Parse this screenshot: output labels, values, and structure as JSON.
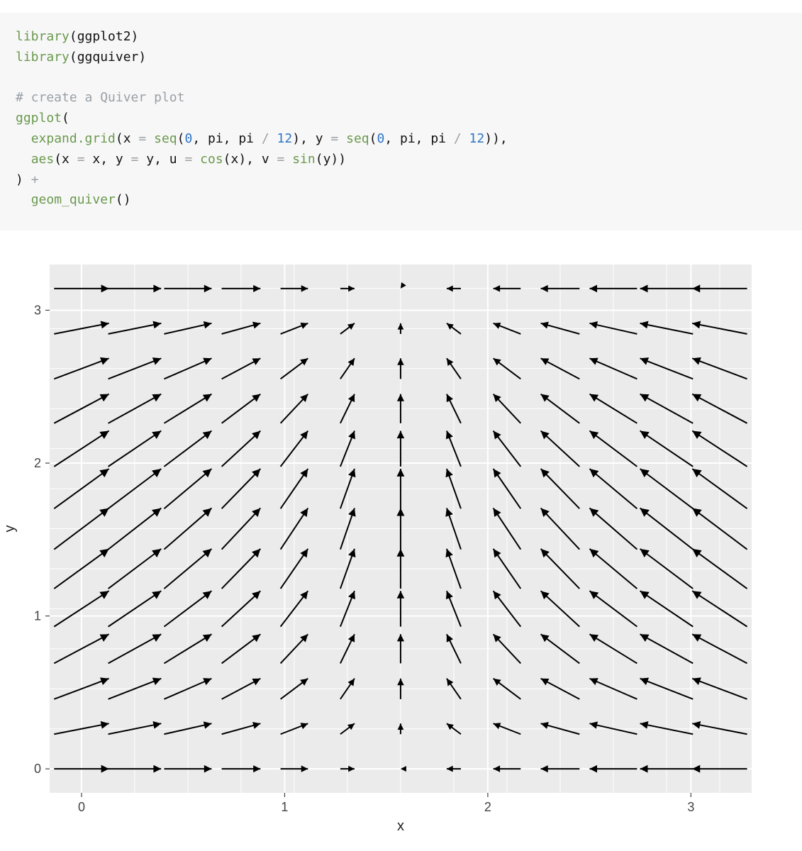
{
  "code": {
    "lines": [
      {
        "t": "mixed",
        "parts": [
          {
            "c": "fn",
            "s": "library"
          },
          {
            "c": "paren",
            "s": "(ggplot2)"
          }
        ]
      },
      {
        "t": "mixed",
        "parts": [
          {
            "c": "fn",
            "s": "library"
          },
          {
            "c": "paren",
            "s": "(ggquiver)"
          }
        ]
      },
      {
        "t": "blank"
      },
      {
        "t": "comment",
        "s": "# create a Quiver plot"
      },
      {
        "t": "mixed",
        "parts": [
          {
            "c": "fn",
            "s": "ggplot"
          },
          {
            "c": "paren",
            "s": "("
          }
        ]
      },
      {
        "t": "mixed",
        "parts": [
          {
            "c": "plain",
            "s": "  "
          },
          {
            "c": "fn",
            "s": "expand.grid"
          },
          {
            "c": "paren",
            "s": "(x "
          },
          {
            "c": "op",
            "s": "="
          },
          {
            "c": "paren",
            "s": " "
          },
          {
            "c": "fn",
            "s": "seq"
          },
          {
            "c": "paren",
            "s": "("
          },
          {
            "c": "num",
            "s": "0"
          },
          {
            "c": "paren",
            "s": ", pi, pi "
          },
          {
            "c": "op",
            "s": "/"
          },
          {
            "c": "paren",
            "s": " "
          },
          {
            "c": "num",
            "s": "12"
          },
          {
            "c": "paren",
            "s": "), y "
          },
          {
            "c": "op",
            "s": "="
          },
          {
            "c": "paren",
            "s": " "
          },
          {
            "c": "fn",
            "s": "seq"
          },
          {
            "c": "paren",
            "s": "("
          },
          {
            "c": "num",
            "s": "0"
          },
          {
            "c": "paren",
            "s": ", pi, pi "
          },
          {
            "c": "op",
            "s": "/"
          },
          {
            "c": "paren",
            "s": " "
          },
          {
            "c": "num",
            "s": "12"
          },
          {
            "c": "paren",
            "s": ")),"
          }
        ]
      },
      {
        "t": "mixed",
        "parts": [
          {
            "c": "plain",
            "s": "  "
          },
          {
            "c": "fn",
            "s": "aes"
          },
          {
            "c": "paren",
            "s": "(x "
          },
          {
            "c": "op",
            "s": "="
          },
          {
            "c": "paren",
            "s": " x, y "
          },
          {
            "c": "op",
            "s": "="
          },
          {
            "c": "paren",
            "s": " y, u "
          },
          {
            "c": "op",
            "s": "="
          },
          {
            "c": "paren",
            "s": " "
          },
          {
            "c": "fn",
            "s": "cos"
          },
          {
            "c": "paren",
            "s": "(x), v "
          },
          {
            "c": "op",
            "s": "="
          },
          {
            "c": "paren",
            "s": " "
          },
          {
            "c": "fn",
            "s": "sin"
          },
          {
            "c": "paren",
            "s": "(y))"
          }
        ]
      },
      {
        "t": "mixed",
        "parts": [
          {
            "c": "paren",
            "s": ") "
          },
          {
            "c": "op",
            "s": "+"
          }
        ]
      },
      {
        "t": "mixed",
        "parts": [
          {
            "c": "plain",
            "s": "  "
          },
          {
            "c": "fn",
            "s": "geom_quiver"
          },
          {
            "c": "paren",
            "s": "()"
          }
        ]
      }
    ]
  },
  "chart_data": {
    "type": "quiver",
    "title": "",
    "xlabel": "x",
    "ylabel": "y",
    "x_ticks": [
      0,
      1,
      2,
      3
    ],
    "y_ticks": [
      0,
      1,
      2,
      3
    ],
    "x_range": [
      -0.157,
      3.299
    ],
    "y_range": [
      -0.157,
      3.299
    ],
    "grid_spacing_x": 0.2618,
    "grid_spacing_y": 0.2618,
    "n": 13,
    "u_formula": "cos(x)",
    "v_formula": "sin(y)",
    "arrow_scale": 0.27,
    "panel": {
      "bg": "#ebebeb",
      "grid_major": "#ffffff",
      "grid_minor": "#ffffff"
    },
    "note": "x,y = seq(0, pi, pi/12) giving 13x13 grid; u=cos(x) in [-1,1], v=sin(y) in [0,1]"
  }
}
